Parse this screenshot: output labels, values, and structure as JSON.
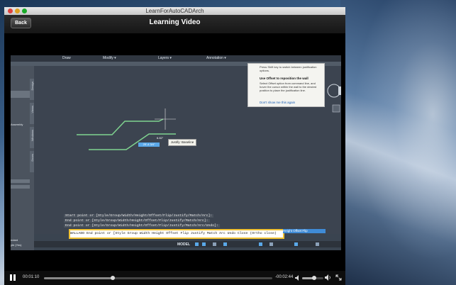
{
  "window": {
    "title": "LearnForAutoCADArch"
  },
  "nav": {
    "back_label": "Back",
    "title": "Learning Video"
  },
  "autocad": {
    "menus": [
      "Draw",
      "Modify ▾",
      "Layers ▾",
      "Annotation ▾"
    ],
    "left_panel": {
      "assembly_label": "Assembly",
      "standard_label": "ndard",
      "style_label": "yle (Yes)"
    },
    "side_tabs": [
      "Design",
      "Views",
      "Windows",
      "Doors"
    ],
    "tooltip": {
      "intro": "Press Shift key to switch between justification options.",
      "heading": "Use Offset to reposition the wall",
      "body": "Select Offset option from command line, and hover the cursor within the wall to the desired position to place the justification line.",
      "link": "Don't show me this again"
    },
    "justify_tip": "Justify: Baseline",
    "dimension": "6.82\"",
    "highlight_value": "25'-4 3/4\"",
    "command_history": [
      "Start point or [Style/Group/Width/Height/Offset/Flip/Justify/Match/Arc]:",
      "End point or [Style/Group/Width/Height/Offset/Flip/Justify/Match/Arc]:",
      "End point or [Style/Group/Width/Height/Offset/Flip/Justify/Match/Arc/Undo]:"
    ],
    "command_line": "WALLADD End point or [Style Group Width Height Offset Flip Justify Match Arc Undo Close (Ortho close)",
    "command_selected": "Height Offset Flip",
    "status_model": "MODEL",
    "colors": {
      "highlight": "#5aa8e8",
      "command_border": "#f1c232",
      "wall_lines": "#7fd38f"
    }
  },
  "player": {
    "elapsed": "00:01:10",
    "remaining": "-00:02:44",
    "progress": 0.3,
    "volume": 0.55,
    "icons": [
      "pause-icon",
      "speaker-low-icon",
      "speaker-high-icon",
      "fullscreen-icon"
    ]
  }
}
